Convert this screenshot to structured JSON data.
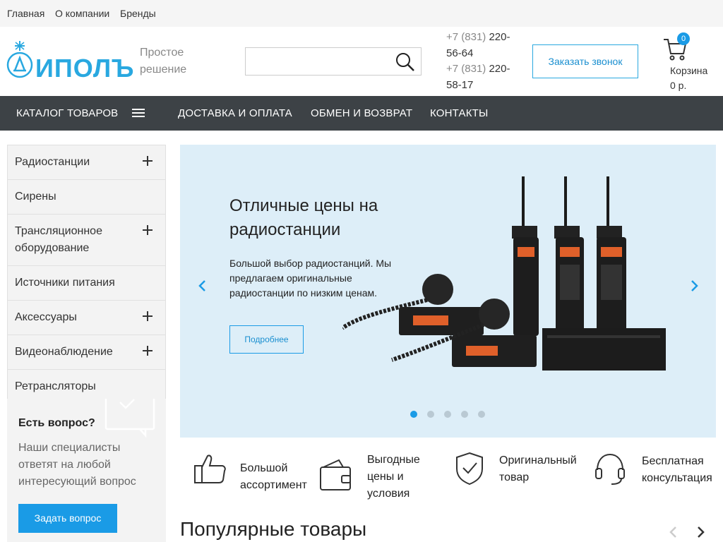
{
  "topnav": {
    "items": [
      "Главная",
      "О компании",
      "Бренды"
    ]
  },
  "header": {
    "logo_text": "ИПОЛЪ",
    "slogan_line1": "Простое",
    "slogan_line2": "решение",
    "search_placeholder": "",
    "phone1_prefix": "+7 (831)",
    "phone1_rest1": "220-",
    "phone1_rest2": "56-64",
    "phone2_prefix": "+7 (831)",
    "phone2_rest1": "220-",
    "phone2_rest2": "58-17",
    "callback_label": "Заказать звонок",
    "cart_count": "0",
    "cart_label": "Корзина",
    "cart_total": "0 р."
  },
  "nav": {
    "catalog_label": "КАТАЛОГ ТОВАРОВ",
    "items": [
      "ДОСТАВКА И ОПЛАТА",
      "ОБМЕН И ВОЗВРАТ",
      "КОНТАКТЫ"
    ]
  },
  "catalog": [
    {
      "label": "Радиостанции",
      "expandable": true
    },
    {
      "label": "Сирены",
      "expandable": false
    },
    {
      "label": "Трансляционное оборудование",
      "expandable": true
    },
    {
      "label": "Источники питания",
      "expandable": false
    },
    {
      "label": "Аксессуары",
      "expandable": true
    },
    {
      "label": "Видеонаблюдение",
      "expandable": true
    },
    {
      "label": "Ретрансляторы",
      "expandable": false
    }
  ],
  "question": {
    "title": "Есть вопрос?",
    "text": "Наши специалисты ответят на любой интересующий вопрос",
    "button": "Задать вопрос"
  },
  "banner": {
    "title": "Отличные цены на радиостанции",
    "text": "Большой выбор радиостанций. Мы предлагаем оригинальные радиостанции по низким ценам.",
    "button": "Подробнее",
    "slides": 5,
    "active_slide": 1
  },
  "features": [
    {
      "icon": "thumbs-up-icon",
      "text": "Большой ассортимент"
    },
    {
      "icon": "wallet-icon",
      "text": "Выгодные цены и условия"
    },
    {
      "icon": "shield-check-icon",
      "text": "Оригинальный товар"
    },
    {
      "icon": "headset-icon",
      "text": "Бесплатная консультация"
    }
  ],
  "popular": {
    "title": "Популярные товары"
  },
  "colors": {
    "accent": "#1a9be6",
    "nav_bg": "#3d4246",
    "banner_bg": "#ddeef8",
    "logo": "#29a8e0"
  }
}
